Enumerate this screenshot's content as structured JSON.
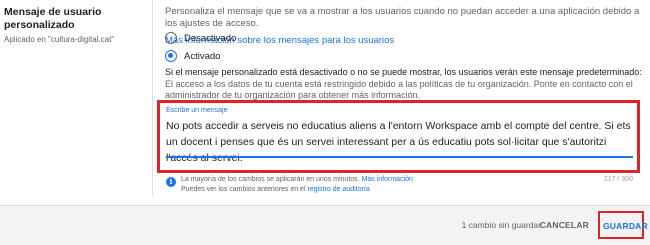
{
  "left": {
    "title": "Mensaje de usuario personalizado",
    "applied": "Aplicado en \"cultura-digital.cat\""
  },
  "main": {
    "description": "Personaliza el mensaje que se va a mostrar a los usuarios cuando no puedan acceder a una aplicación debido a los ajustes de acceso.",
    "more_info_link": "Más información sobre los mensajes para los usuarios",
    "options": [
      {
        "label": "Desactivado",
        "checked": false
      },
      {
        "label": "Activado",
        "checked": true
      }
    ],
    "fallback_title": "Si el mensaje personalizado está desactivado o no se puede mostrar, los usuarios verán este mensaje predeterminado:",
    "fallback_text": "El acceso a los datos de tu cuenta está restringido debido a las políticas de tu organización. Ponte en contacto con el administrador de tu organización para obtener más información."
  },
  "message_field": {
    "label": "Escribe un mensaje",
    "value": "No pots accedir a serveis no educatius aliens a l'entorn Workspace amb el compte del centre. Si ets un docent i penses que és un servei interessant per a ús educatiu pots sol·licitar que s'autoritzi l'accés al servei.",
    "counter": "217 / 300"
  },
  "info": {
    "line1": "La mayoría de los cambios se aplicarán en unos minutos.",
    "line1_link": "Más información",
    "line2": "Puedes ver los cambios anteriores en el",
    "line2_link": "registro de auditoría",
    "icon": "info-icon"
  },
  "footer": {
    "unsaved": "1 cambio sin guardar",
    "cancel": "CANCELAR",
    "save": "GUARDAR"
  },
  "colors": {
    "accent": "#1a73e8",
    "highlight": "#e0222b"
  }
}
